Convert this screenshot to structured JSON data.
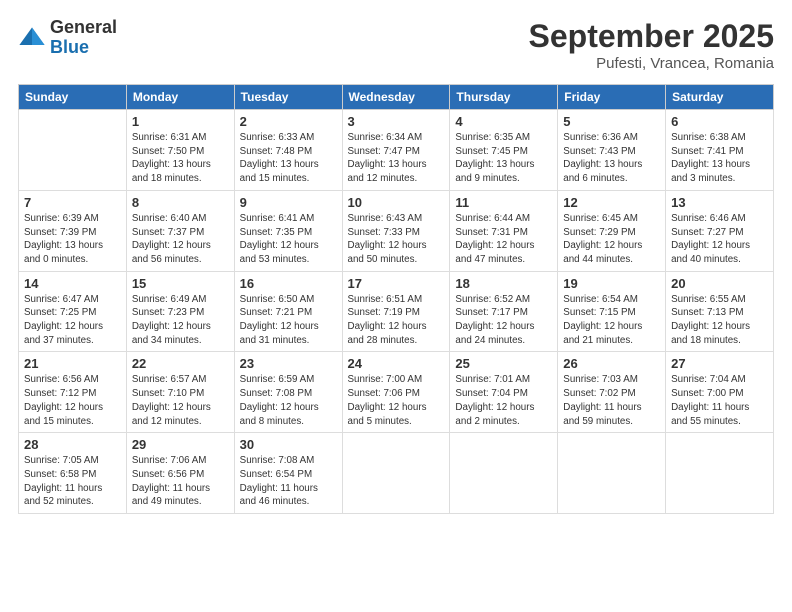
{
  "header": {
    "logo_general": "General",
    "logo_blue": "Blue",
    "month_title": "September 2025",
    "location": "Pufesti, Vrancea, Romania"
  },
  "days_of_week": [
    "Sunday",
    "Monday",
    "Tuesday",
    "Wednesday",
    "Thursday",
    "Friday",
    "Saturday"
  ],
  "weeks": [
    [
      {
        "day": "",
        "info": ""
      },
      {
        "day": "1",
        "info": "Sunrise: 6:31 AM\nSunset: 7:50 PM\nDaylight: 13 hours\nand 18 minutes."
      },
      {
        "day": "2",
        "info": "Sunrise: 6:33 AM\nSunset: 7:48 PM\nDaylight: 13 hours\nand 15 minutes."
      },
      {
        "day": "3",
        "info": "Sunrise: 6:34 AM\nSunset: 7:47 PM\nDaylight: 13 hours\nand 12 minutes."
      },
      {
        "day": "4",
        "info": "Sunrise: 6:35 AM\nSunset: 7:45 PM\nDaylight: 13 hours\nand 9 minutes."
      },
      {
        "day": "5",
        "info": "Sunrise: 6:36 AM\nSunset: 7:43 PM\nDaylight: 13 hours\nand 6 minutes."
      },
      {
        "day": "6",
        "info": "Sunrise: 6:38 AM\nSunset: 7:41 PM\nDaylight: 13 hours\nand 3 minutes."
      }
    ],
    [
      {
        "day": "7",
        "info": "Sunrise: 6:39 AM\nSunset: 7:39 PM\nDaylight: 13 hours\nand 0 minutes."
      },
      {
        "day": "8",
        "info": "Sunrise: 6:40 AM\nSunset: 7:37 PM\nDaylight: 12 hours\nand 56 minutes."
      },
      {
        "day": "9",
        "info": "Sunrise: 6:41 AM\nSunset: 7:35 PM\nDaylight: 12 hours\nand 53 minutes."
      },
      {
        "day": "10",
        "info": "Sunrise: 6:43 AM\nSunset: 7:33 PM\nDaylight: 12 hours\nand 50 minutes."
      },
      {
        "day": "11",
        "info": "Sunrise: 6:44 AM\nSunset: 7:31 PM\nDaylight: 12 hours\nand 47 minutes."
      },
      {
        "day": "12",
        "info": "Sunrise: 6:45 AM\nSunset: 7:29 PM\nDaylight: 12 hours\nand 44 minutes."
      },
      {
        "day": "13",
        "info": "Sunrise: 6:46 AM\nSunset: 7:27 PM\nDaylight: 12 hours\nand 40 minutes."
      }
    ],
    [
      {
        "day": "14",
        "info": "Sunrise: 6:47 AM\nSunset: 7:25 PM\nDaylight: 12 hours\nand 37 minutes."
      },
      {
        "day": "15",
        "info": "Sunrise: 6:49 AM\nSunset: 7:23 PM\nDaylight: 12 hours\nand 34 minutes."
      },
      {
        "day": "16",
        "info": "Sunrise: 6:50 AM\nSunset: 7:21 PM\nDaylight: 12 hours\nand 31 minutes."
      },
      {
        "day": "17",
        "info": "Sunrise: 6:51 AM\nSunset: 7:19 PM\nDaylight: 12 hours\nand 28 minutes."
      },
      {
        "day": "18",
        "info": "Sunrise: 6:52 AM\nSunset: 7:17 PM\nDaylight: 12 hours\nand 24 minutes."
      },
      {
        "day": "19",
        "info": "Sunrise: 6:54 AM\nSunset: 7:15 PM\nDaylight: 12 hours\nand 21 minutes."
      },
      {
        "day": "20",
        "info": "Sunrise: 6:55 AM\nSunset: 7:13 PM\nDaylight: 12 hours\nand 18 minutes."
      }
    ],
    [
      {
        "day": "21",
        "info": "Sunrise: 6:56 AM\nSunset: 7:12 PM\nDaylight: 12 hours\nand 15 minutes."
      },
      {
        "day": "22",
        "info": "Sunrise: 6:57 AM\nSunset: 7:10 PM\nDaylight: 12 hours\nand 12 minutes."
      },
      {
        "day": "23",
        "info": "Sunrise: 6:59 AM\nSunset: 7:08 PM\nDaylight: 12 hours\nand 8 minutes."
      },
      {
        "day": "24",
        "info": "Sunrise: 7:00 AM\nSunset: 7:06 PM\nDaylight: 12 hours\nand 5 minutes."
      },
      {
        "day": "25",
        "info": "Sunrise: 7:01 AM\nSunset: 7:04 PM\nDaylight: 12 hours\nand 2 minutes."
      },
      {
        "day": "26",
        "info": "Sunrise: 7:03 AM\nSunset: 7:02 PM\nDaylight: 11 hours\nand 59 minutes."
      },
      {
        "day": "27",
        "info": "Sunrise: 7:04 AM\nSunset: 7:00 PM\nDaylight: 11 hours\nand 55 minutes."
      }
    ],
    [
      {
        "day": "28",
        "info": "Sunrise: 7:05 AM\nSunset: 6:58 PM\nDaylight: 11 hours\nand 52 minutes."
      },
      {
        "day": "29",
        "info": "Sunrise: 7:06 AM\nSunset: 6:56 PM\nDaylight: 11 hours\nand 49 minutes."
      },
      {
        "day": "30",
        "info": "Sunrise: 7:08 AM\nSunset: 6:54 PM\nDaylight: 11 hours\nand 46 minutes."
      },
      {
        "day": "",
        "info": ""
      },
      {
        "day": "",
        "info": ""
      },
      {
        "day": "",
        "info": ""
      },
      {
        "day": "",
        "info": ""
      }
    ]
  ]
}
